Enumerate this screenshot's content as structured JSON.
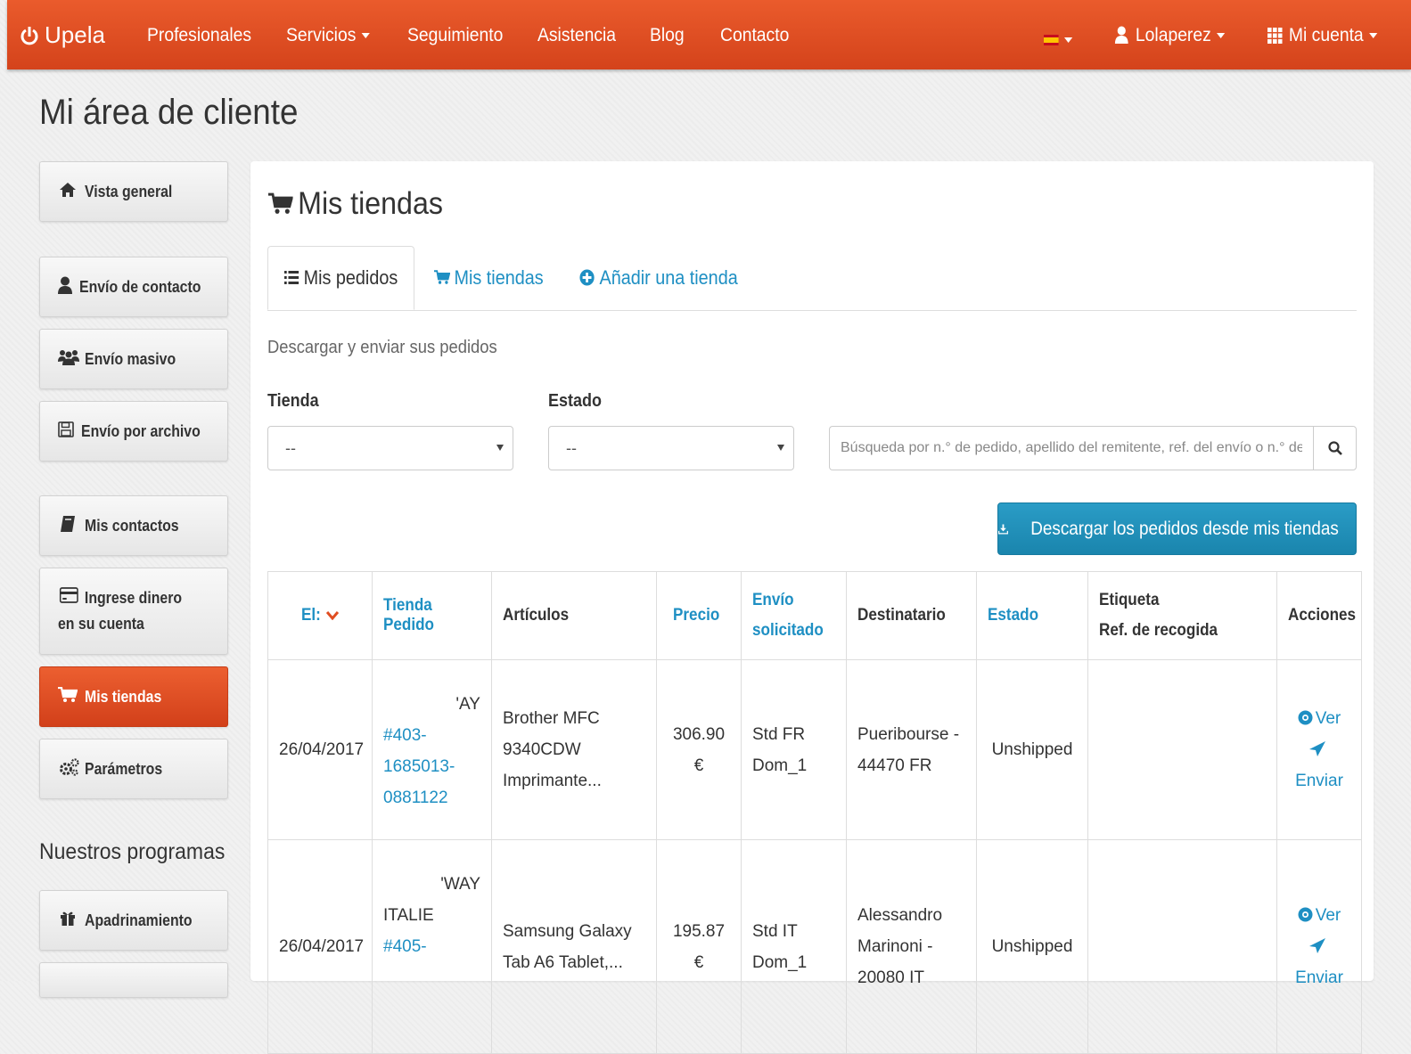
{
  "navbar": {
    "brand": "Upela",
    "items": [
      "Profesionales",
      "Servicios",
      "Seguimiento",
      "Asistencia",
      "Blog",
      "Contacto"
    ],
    "user": "Lolaperez",
    "account": "Mi cuenta",
    "accent": "#e04e22"
  },
  "page": {
    "title": "Mi área de cliente"
  },
  "sidebar": {
    "items": [
      {
        "label": "Vista general",
        "icon": "home-icon"
      },
      {
        "label": "Envío de contacto",
        "icon": "user-icon"
      },
      {
        "label": "Envío masivo",
        "icon": "users-icon"
      },
      {
        "label": "Envío por archivo",
        "icon": "floppy-icon"
      },
      {
        "label": "Mis contactos",
        "icon": "book-icon"
      },
      {
        "label": "Ingrese dinero en su cuenta",
        "icon": "credit-card-icon"
      },
      {
        "label": "Mis tiendas",
        "icon": "cart-icon",
        "active": true
      },
      {
        "label": "Parámetros",
        "icon": "gears-icon"
      }
    ],
    "programs_title": "Nuestros programas",
    "programs": [
      {
        "label": "Apadrinamiento",
        "icon": "gift-icon"
      }
    ]
  },
  "main": {
    "title": "Mis tiendas",
    "tabs": [
      {
        "label": "Mis pedidos",
        "icon": "list-icon",
        "active": true
      },
      {
        "label": "Mis tiendas",
        "icon": "cart-icon"
      },
      {
        "label": "Añadir una tienda",
        "icon": "plus-circle-icon"
      }
    ],
    "subtitle": "Descargar y enviar sus pedidos",
    "filters": {
      "store_label": "Tienda",
      "store_value": "--",
      "status_label": "Estado",
      "status_value": "--",
      "search_placeholder": "Búsqueda por n.° de pedido, apellido del remitente, ref. del envío o n.° de seguimiento"
    },
    "download_button": "Descargar los pedidos desde mis tiendas"
  },
  "table": {
    "headers": {
      "date": "El:",
      "store_l1": "Tienda",
      "store_l2": "Pedido",
      "articles": "Artículos",
      "price": "Precio",
      "shipping_l1": "Envío",
      "shipping_l2": "solicitado",
      "recipient": "Destinatario",
      "status": "Estado",
      "label_l1": "Etiqueta",
      "label_l2": "Ref. de recogida",
      "actions": "Acciones"
    },
    "rows": [
      {
        "date": "26/04/2017",
        "store_l1": "'AY",
        "order_l1": "#403-",
        "order_l2": "1685013-",
        "order_l3": "0881122",
        "articles_l1": "Brother MFC",
        "articles_l2": "9340CDW",
        "articles_l3": "Imprimante...",
        "price": "306.90 €",
        "shipping_l1": "Std FR",
        "shipping_l2": "Dom_1",
        "recipient_l1": "Pueribourse -",
        "recipient_l2": "44470 FR",
        "status": "Unshipped",
        "view": "Ver",
        "send": "Enviar"
      },
      {
        "date": "26/04/2017",
        "store_l1": "'WAY",
        "store_l2": "ITALIE",
        "order_l1": "#405-",
        "articles_l1": "Samsung Galaxy",
        "articles_l2": "Tab A6 Tablet,...",
        "price": "195.87 €",
        "shipping_l1": "Std IT",
        "shipping_l2": "Dom_1",
        "recipient_l1": "Alessandro",
        "recipient_l2": "Marinoni -",
        "recipient_l3": "20080 IT",
        "status": "Unshipped",
        "view": "Ver",
        "send": "Enviar"
      }
    ]
  }
}
